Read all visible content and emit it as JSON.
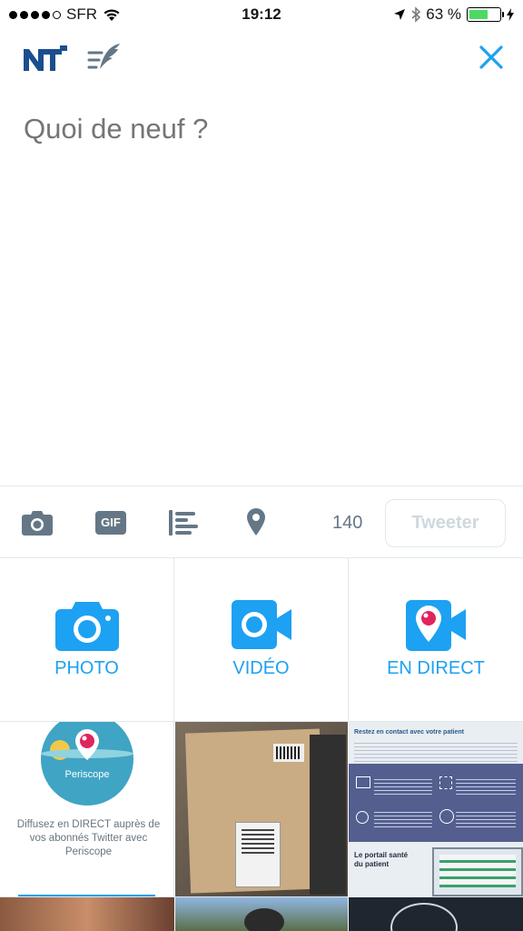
{
  "status_bar": {
    "carrier": "SFR",
    "time": "19:12",
    "battery_percent": "63 %",
    "battery_level": 0.63
  },
  "compose": {
    "placeholder": "Quoi de neuf ?"
  },
  "toolbar": {
    "char_count": "140",
    "tweet_label": "Tweeter",
    "gif_label": "GIF"
  },
  "media_actions": [
    {
      "label": "PHOTO",
      "icon": "camera-icon"
    },
    {
      "label": "VIDÉO",
      "icon": "video-camera-icon"
    },
    {
      "label": "EN DIRECT",
      "icon": "periscope-icon"
    }
  ],
  "periscope_promo": {
    "brand": "Periscope",
    "text": "Diffusez en DIRECT auprès de vos abonnés Twitter avec Periscope"
  },
  "brochure": {
    "heading": "Restez en contact avec votre patient",
    "subheading": "Le portail santé du patient"
  },
  "colors": {
    "accent": "#1da1f2",
    "icon_gray": "#657786",
    "border": "#e1e8ed"
  }
}
